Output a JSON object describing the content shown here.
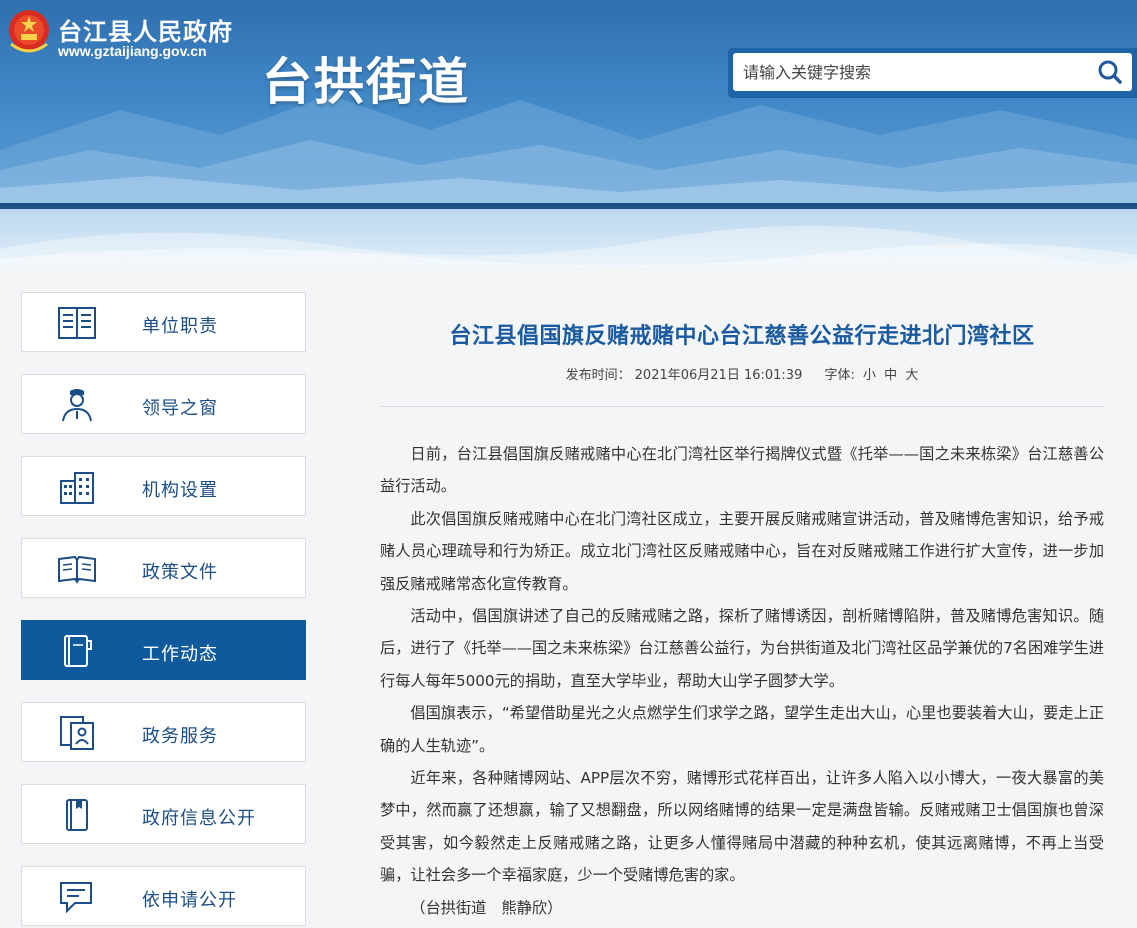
{
  "header": {
    "site_name": "台江县人民政府",
    "site_url": "www.gztaijiang.gov.cn",
    "page_title": "台拱街道",
    "search_placeholder": "请输入关键字搜索",
    "search_icon": "search-icon"
  },
  "colors": {
    "header_blue": "#3f86c6",
    "nav_active": "#0f5a9c",
    "title_blue": "#1a5aa0",
    "nav_text": "#1b4e86"
  },
  "sidebar": {
    "items": [
      {
        "label": "单位职责",
        "icon": "document-list-icon",
        "active": false
      },
      {
        "label": "领导之窗",
        "icon": "person-icon",
        "active": false
      },
      {
        "label": "机构设置",
        "icon": "building-icon",
        "active": false
      },
      {
        "label": "政策文件",
        "icon": "open-book-icon",
        "active": false
      },
      {
        "label": "工作动态",
        "icon": "notebook-icon",
        "active": true
      },
      {
        "label": "政务服务",
        "icon": "service-card-icon",
        "active": false
      },
      {
        "label": "政府信息公开",
        "icon": "book-icon",
        "active": false
      },
      {
        "label": "依申请公开",
        "icon": "chat-bubble-icon",
        "active": false
      }
    ]
  },
  "article": {
    "title": "台江县倡国旗反赌戒赌中心台江慈善公益行走进北门湾社区",
    "publish_label": "发布时间：",
    "publish_time": "2021年06月21日 16:01:39",
    "font_label": "字体:",
    "font_small": "小",
    "font_medium": "中",
    "font_large": "大",
    "paragraphs": [
      "日前，台江县倡国旗反赌戒赌中心在北门湾社区举行揭牌仪式暨《托举——国之未来栋梁》台江慈善公益行活动。",
      "此次倡国旗反赌戒赌中心在北门湾社区成立，主要开展反赌戒赌宣讲活动，普及赌博危害知识，给予戒赌人员心理疏导和行为矫正。成立北门湾社区反赌戒赌中心，旨在对反赌戒赌工作进行扩大宣传，进一步加强反赌戒赌常态化宣传教育。",
      "活动中，倡国旗讲述了自己的反赌戒赌之路，探析了赌博诱因，剖析赌博陷阱，普及赌博危害知识。随后，进行了《托举——国之未来栋梁》台江慈善公益行，为台拱街道及北门湾社区品学兼优的7名困难学生进行每人每年5000元的捐助，直至大学毕业，帮助大山学子圆梦大学。",
      "倡国旗表示，“希望借助星光之火点燃学生们求学之路，望学生走出大山，心里也要装着大山，要走上正确的人生轨迹”。",
      "近年来，各种赌博网站、APP层次不穷，赌博形式花样百出，让许多人陷入以小博大，一夜大暴富的美梦中，然而赢了还想赢，输了又想翻盘，所以网络赌博的结果一定是满盘皆输。反赌戒赌卫士倡国旗也曾深受其害，如今毅然走上反赌戒赌之路，让更多人懂得赌局中潜藏的种种玄机，使其远离赌博，不再上当受骗，让社会多一个幸福家庭，少一个受赌博危害的家。"
    ],
    "byline": "（台拱街道　熊静欣）"
  }
}
